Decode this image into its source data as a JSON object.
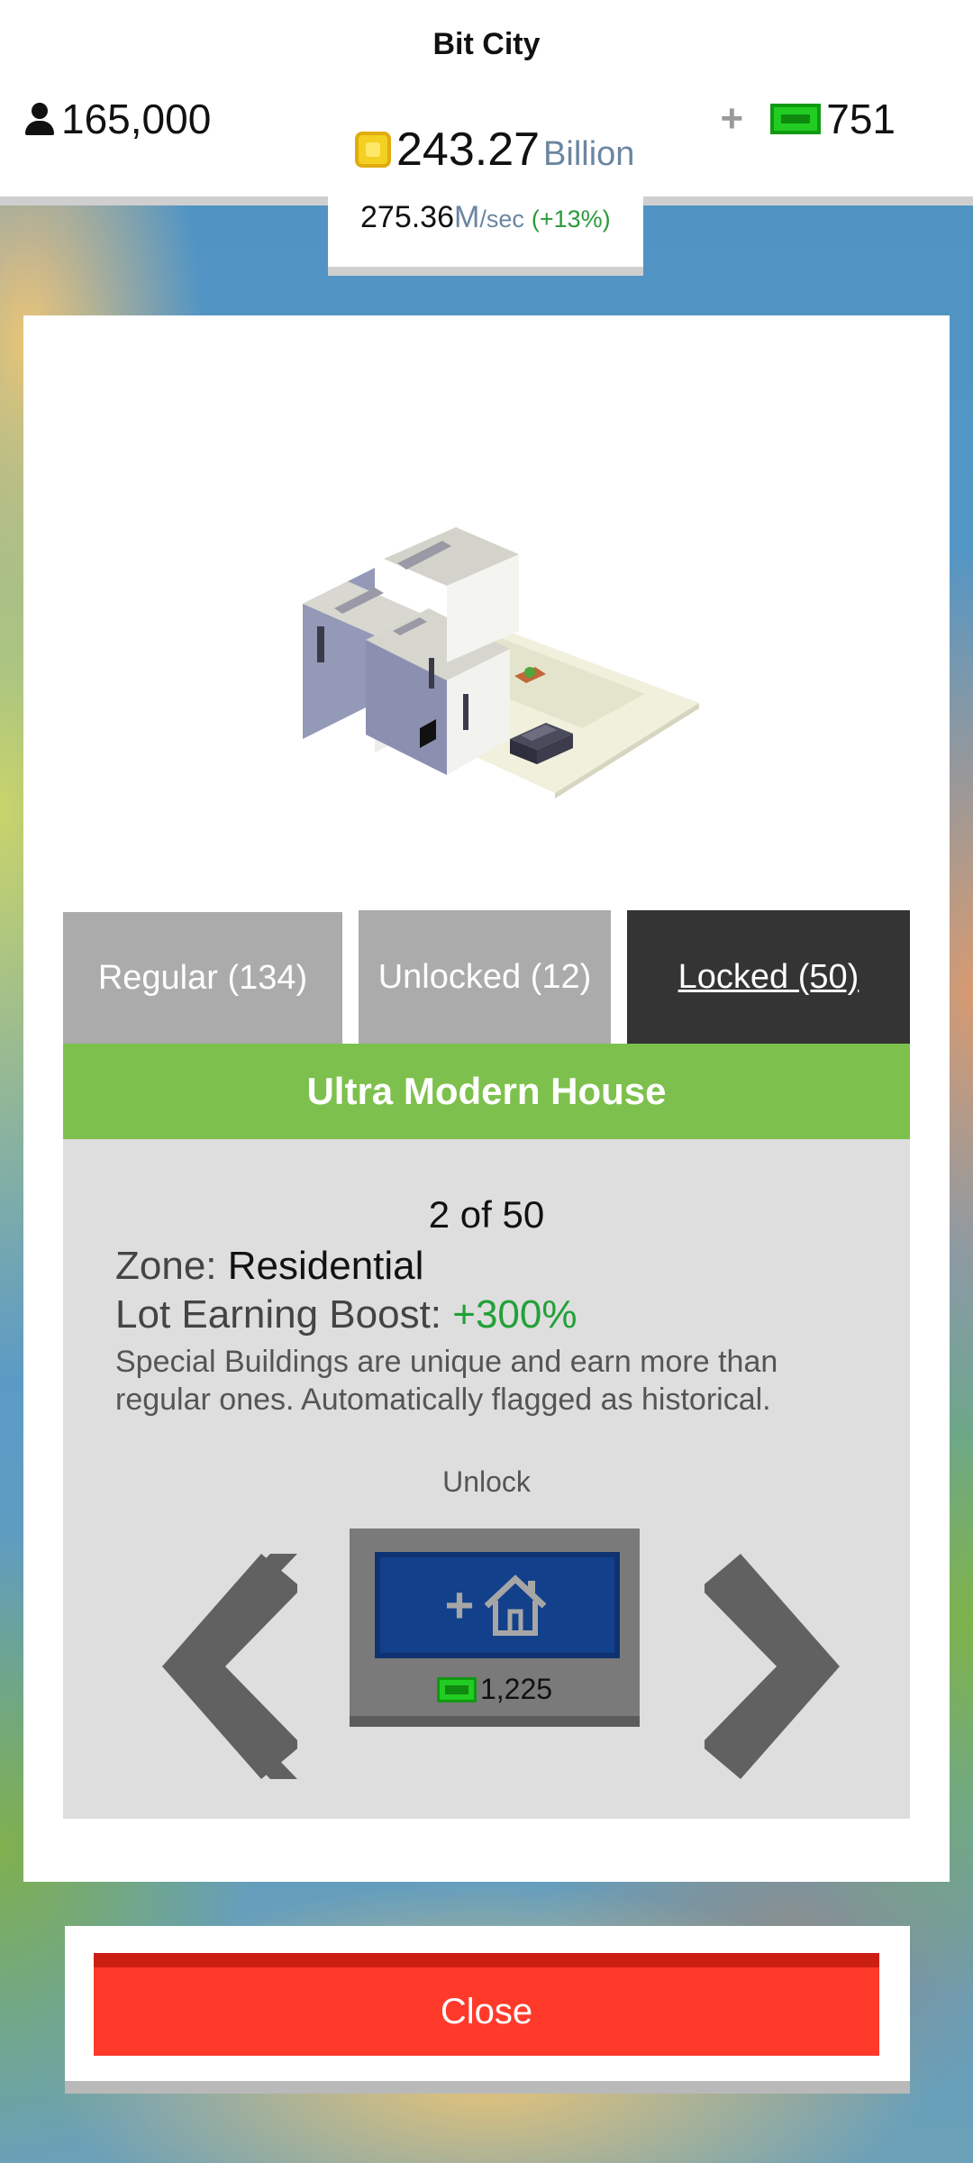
{
  "header": {
    "title": "Bit City",
    "population": "165,000",
    "coins": "243.27",
    "coins_unit": "Billion",
    "rate_value": "275.36",
    "rate_unit_m": "M",
    "rate_unit_s": "/sec",
    "rate_change": "(+13%)",
    "cash": "751",
    "plus_symbol": "+"
  },
  "tabs": [
    {
      "label": "Regular (134)",
      "selected": false
    },
    {
      "label": "Unlocked (12)",
      "selected": false
    },
    {
      "label": "Locked (50)",
      "selected": true
    }
  ],
  "building": {
    "name": "Ultra Modern House",
    "counter": "2 of 50",
    "zone_label": "Zone:",
    "zone_value": "Residential",
    "boost_label": "Lot Earning Boost:",
    "boost_value": "+300%",
    "description": "Special Buildings are unique and earn more than regular ones. Automatically flagged as historical."
  },
  "unlock": {
    "label": "Unlock",
    "price": "1,225",
    "icon": "add-house-icon"
  },
  "close_label": "Close",
  "colors": {
    "accent_green": "#7ec04d",
    "close_red": "#ff3a2a",
    "selected_tab": "#343434",
    "unlock_blue": "#13408a"
  }
}
